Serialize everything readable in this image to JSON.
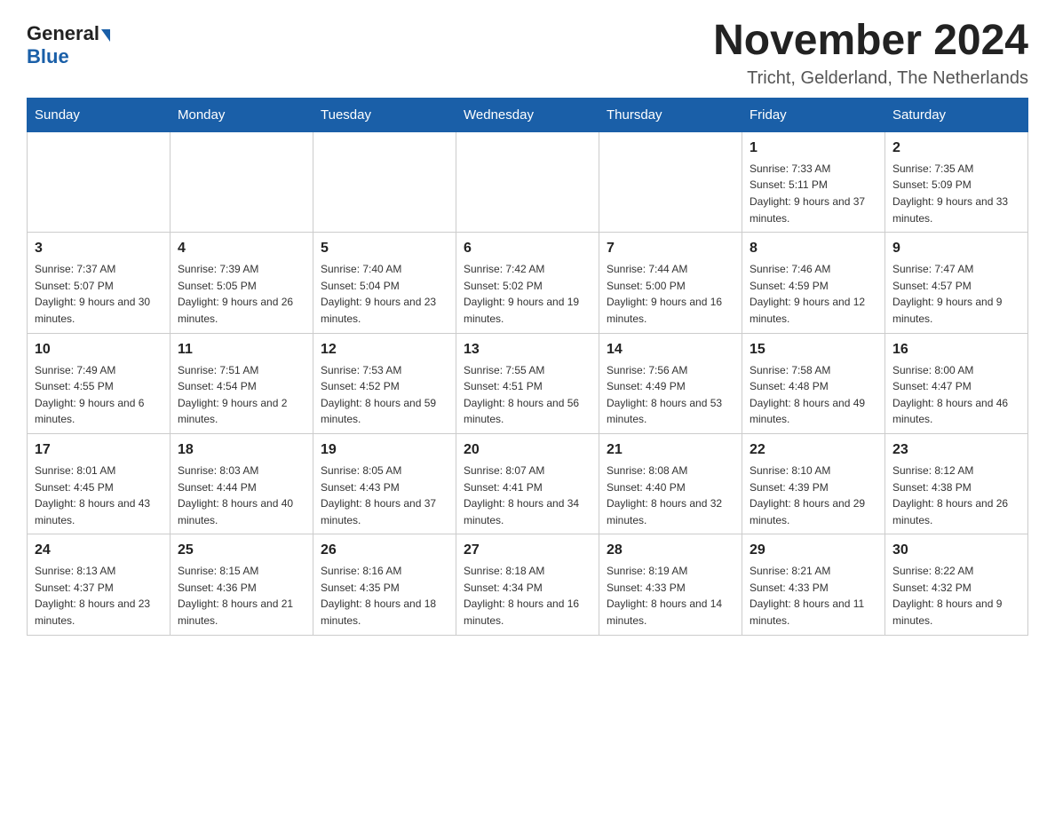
{
  "header": {
    "logo_general": "General",
    "logo_blue": "Blue",
    "month_title": "November 2024",
    "location": "Tricht, Gelderland, The Netherlands"
  },
  "weekdays": [
    "Sunday",
    "Monday",
    "Tuesday",
    "Wednesday",
    "Thursday",
    "Friday",
    "Saturday"
  ],
  "weeks": [
    [
      {
        "day": "",
        "info": ""
      },
      {
        "day": "",
        "info": ""
      },
      {
        "day": "",
        "info": ""
      },
      {
        "day": "",
        "info": ""
      },
      {
        "day": "",
        "info": ""
      },
      {
        "day": "1",
        "info": "Sunrise: 7:33 AM\nSunset: 5:11 PM\nDaylight: 9 hours and 37 minutes."
      },
      {
        "day": "2",
        "info": "Sunrise: 7:35 AM\nSunset: 5:09 PM\nDaylight: 9 hours and 33 minutes."
      }
    ],
    [
      {
        "day": "3",
        "info": "Sunrise: 7:37 AM\nSunset: 5:07 PM\nDaylight: 9 hours and 30 minutes."
      },
      {
        "day": "4",
        "info": "Sunrise: 7:39 AM\nSunset: 5:05 PM\nDaylight: 9 hours and 26 minutes."
      },
      {
        "day": "5",
        "info": "Sunrise: 7:40 AM\nSunset: 5:04 PM\nDaylight: 9 hours and 23 minutes."
      },
      {
        "day": "6",
        "info": "Sunrise: 7:42 AM\nSunset: 5:02 PM\nDaylight: 9 hours and 19 minutes."
      },
      {
        "day": "7",
        "info": "Sunrise: 7:44 AM\nSunset: 5:00 PM\nDaylight: 9 hours and 16 minutes."
      },
      {
        "day": "8",
        "info": "Sunrise: 7:46 AM\nSunset: 4:59 PM\nDaylight: 9 hours and 12 minutes."
      },
      {
        "day": "9",
        "info": "Sunrise: 7:47 AM\nSunset: 4:57 PM\nDaylight: 9 hours and 9 minutes."
      }
    ],
    [
      {
        "day": "10",
        "info": "Sunrise: 7:49 AM\nSunset: 4:55 PM\nDaylight: 9 hours and 6 minutes."
      },
      {
        "day": "11",
        "info": "Sunrise: 7:51 AM\nSunset: 4:54 PM\nDaylight: 9 hours and 2 minutes."
      },
      {
        "day": "12",
        "info": "Sunrise: 7:53 AM\nSunset: 4:52 PM\nDaylight: 8 hours and 59 minutes."
      },
      {
        "day": "13",
        "info": "Sunrise: 7:55 AM\nSunset: 4:51 PM\nDaylight: 8 hours and 56 minutes."
      },
      {
        "day": "14",
        "info": "Sunrise: 7:56 AM\nSunset: 4:49 PM\nDaylight: 8 hours and 53 minutes."
      },
      {
        "day": "15",
        "info": "Sunrise: 7:58 AM\nSunset: 4:48 PM\nDaylight: 8 hours and 49 minutes."
      },
      {
        "day": "16",
        "info": "Sunrise: 8:00 AM\nSunset: 4:47 PM\nDaylight: 8 hours and 46 minutes."
      }
    ],
    [
      {
        "day": "17",
        "info": "Sunrise: 8:01 AM\nSunset: 4:45 PM\nDaylight: 8 hours and 43 minutes."
      },
      {
        "day": "18",
        "info": "Sunrise: 8:03 AM\nSunset: 4:44 PM\nDaylight: 8 hours and 40 minutes."
      },
      {
        "day": "19",
        "info": "Sunrise: 8:05 AM\nSunset: 4:43 PM\nDaylight: 8 hours and 37 minutes."
      },
      {
        "day": "20",
        "info": "Sunrise: 8:07 AM\nSunset: 4:41 PM\nDaylight: 8 hours and 34 minutes."
      },
      {
        "day": "21",
        "info": "Sunrise: 8:08 AM\nSunset: 4:40 PM\nDaylight: 8 hours and 32 minutes."
      },
      {
        "day": "22",
        "info": "Sunrise: 8:10 AM\nSunset: 4:39 PM\nDaylight: 8 hours and 29 minutes."
      },
      {
        "day": "23",
        "info": "Sunrise: 8:12 AM\nSunset: 4:38 PM\nDaylight: 8 hours and 26 minutes."
      }
    ],
    [
      {
        "day": "24",
        "info": "Sunrise: 8:13 AM\nSunset: 4:37 PM\nDaylight: 8 hours and 23 minutes."
      },
      {
        "day": "25",
        "info": "Sunrise: 8:15 AM\nSunset: 4:36 PM\nDaylight: 8 hours and 21 minutes."
      },
      {
        "day": "26",
        "info": "Sunrise: 8:16 AM\nSunset: 4:35 PM\nDaylight: 8 hours and 18 minutes."
      },
      {
        "day": "27",
        "info": "Sunrise: 8:18 AM\nSunset: 4:34 PM\nDaylight: 8 hours and 16 minutes."
      },
      {
        "day": "28",
        "info": "Sunrise: 8:19 AM\nSunset: 4:33 PM\nDaylight: 8 hours and 14 minutes."
      },
      {
        "day": "29",
        "info": "Sunrise: 8:21 AM\nSunset: 4:33 PM\nDaylight: 8 hours and 11 minutes."
      },
      {
        "day": "30",
        "info": "Sunrise: 8:22 AM\nSunset: 4:32 PM\nDaylight: 8 hours and 9 minutes."
      }
    ]
  ]
}
